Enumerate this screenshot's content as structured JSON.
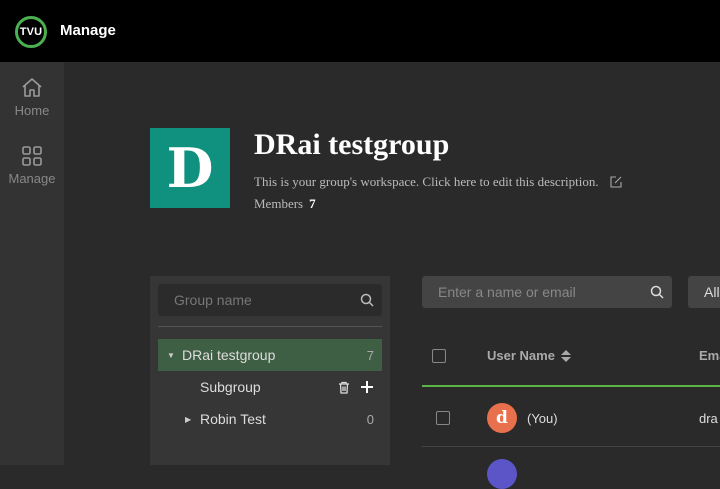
{
  "header": {
    "logo_text": "TVU",
    "title": "Manage"
  },
  "sidebar": {
    "items": [
      {
        "label": "Home",
        "icon": "home-icon"
      },
      {
        "label": "Manage",
        "icon": "grid-icon"
      }
    ]
  },
  "group": {
    "avatar_letter": "D",
    "avatar_color": "#10907e",
    "name": "DRai testgroup",
    "description": "This is your group's workspace. Click here to edit this description.",
    "members_label": "Members",
    "members_count": "7"
  },
  "tree": {
    "search_placeholder": "Group name",
    "nodes": [
      {
        "label": "DRai testgroup",
        "count": "7",
        "expanded": true,
        "selected": true
      },
      {
        "label": "Subgroup",
        "count": ""
      },
      {
        "label": "Robin Test",
        "count": "0",
        "expanded": false
      }
    ]
  },
  "users": {
    "search_placeholder": "Enter a name or email",
    "filter_label": "All",
    "columns": [
      "User Name",
      "Email"
    ],
    "rows": [
      {
        "avatar_letter": "d",
        "name": "(You)",
        "email": "dra"
      }
    ]
  },
  "colors": {
    "accent": "#5bb544",
    "selected_bg": "#3f5f45"
  }
}
